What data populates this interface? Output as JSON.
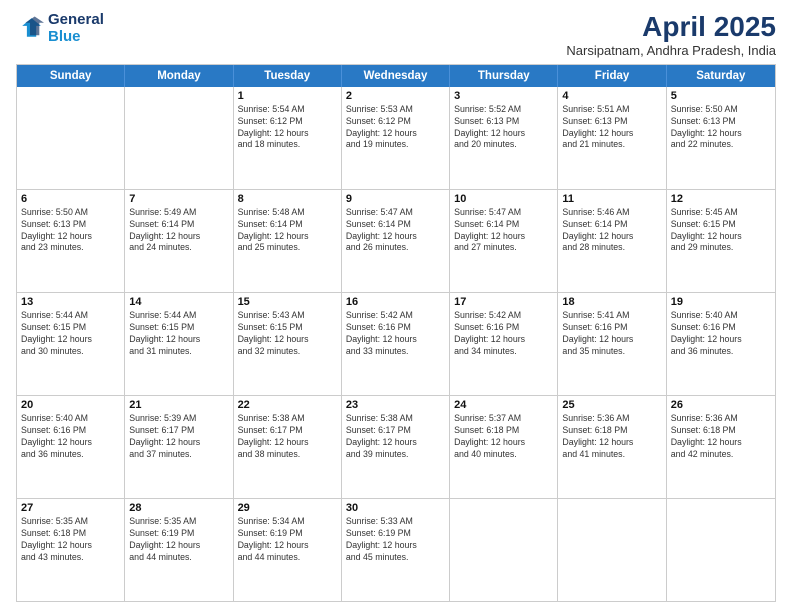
{
  "logo": {
    "line1": "General",
    "line2": "Blue"
  },
  "title": "April 2025",
  "subtitle": "Narsipatnam, Andhra Pradesh, India",
  "headers": [
    "Sunday",
    "Monday",
    "Tuesday",
    "Wednesday",
    "Thursday",
    "Friday",
    "Saturday"
  ],
  "weeks": [
    [
      {
        "day": "",
        "info": ""
      },
      {
        "day": "",
        "info": ""
      },
      {
        "day": "1",
        "info": "Sunrise: 5:54 AM\nSunset: 6:12 PM\nDaylight: 12 hours\nand 18 minutes."
      },
      {
        "day": "2",
        "info": "Sunrise: 5:53 AM\nSunset: 6:12 PM\nDaylight: 12 hours\nand 19 minutes."
      },
      {
        "day": "3",
        "info": "Sunrise: 5:52 AM\nSunset: 6:13 PM\nDaylight: 12 hours\nand 20 minutes."
      },
      {
        "day": "4",
        "info": "Sunrise: 5:51 AM\nSunset: 6:13 PM\nDaylight: 12 hours\nand 21 minutes."
      },
      {
        "day": "5",
        "info": "Sunrise: 5:50 AM\nSunset: 6:13 PM\nDaylight: 12 hours\nand 22 minutes."
      }
    ],
    [
      {
        "day": "6",
        "info": "Sunrise: 5:50 AM\nSunset: 6:13 PM\nDaylight: 12 hours\nand 23 minutes."
      },
      {
        "day": "7",
        "info": "Sunrise: 5:49 AM\nSunset: 6:14 PM\nDaylight: 12 hours\nand 24 minutes."
      },
      {
        "day": "8",
        "info": "Sunrise: 5:48 AM\nSunset: 6:14 PM\nDaylight: 12 hours\nand 25 minutes."
      },
      {
        "day": "9",
        "info": "Sunrise: 5:47 AM\nSunset: 6:14 PM\nDaylight: 12 hours\nand 26 minutes."
      },
      {
        "day": "10",
        "info": "Sunrise: 5:47 AM\nSunset: 6:14 PM\nDaylight: 12 hours\nand 27 minutes."
      },
      {
        "day": "11",
        "info": "Sunrise: 5:46 AM\nSunset: 6:14 PM\nDaylight: 12 hours\nand 28 minutes."
      },
      {
        "day": "12",
        "info": "Sunrise: 5:45 AM\nSunset: 6:15 PM\nDaylight: 12 hours\nand 29 minutes."
      }
    ],
    [
      {
        "day": "13",
        "info": "Sunrise: 5:44 AM\nSunset: 6:15 PM\nDaylight: 12 hours\nand 30 minutes."
      },
      {
        "day": "14",
        "info": "Sunrise: 5:44 AM\nSunset: 6:15 PM\nDaylight: 12 hours\nand 31 minutes."
      },
      {
        "day": "15",
        "info": "Sunrise: 5:43 AM\nSunset: 6:15 PM\nDaylight: 12 hours\nand 32 minutes."
      },
      {
        "day": "16",
        "info": "Sunrise: 5:42 AM\nSunset: 6:16 PM\nDaylight: 12 hours\nand 33 minutes."
      },
      {
        "day": "17",
        "info": "Sunrise: 5:42 AM\nSunset: 6:16 PM\nDaylight: 12 hours\nand 34 minutes."
      },
      {
        "day": "18",
        "info": "Sunrise: 5:41 AM\nSunset: 6:16 PM\nDaylight: 12 hours\nand 35 minutes."
      },
      {
        "day": "19",
        "info": "Sunrise: 5:40 AM\nSunset: 6:16 PM\nDaylight: 12 hours\nand 36 minutes."
      }
    ],
    [
      {
        "day": "20",
        "info": "Sunrise: 5:40 AM\nSunset: 6:16 PM\nDaylight: 12 hours\nand 36 minutes."
      },
      {
        "day": "21",
        "info": "Sunrise: 5:39 AM\nSunset: 6:17 PM\nDaylight: 12 hours\nand 37 minutes."
      },
      {
        "day": "22",
        "info": "Sunrise: 5:38 AM\nSunset: 6:17 PM\nDaylight: 12 hours\nand 38 minutes."
      },
      {
        "day": "23",
        "info": "Sunrise: 5:38 AM\nSunset: 6:17 PM\nDaylight: 12 hours\nand 39 minutes."
      },
      {
        "day": "24",
        "info": "Sunrise: 5:37 AM\nSunset: 6:18 PM\nDaylight: 12 hours\nand 40 minutes."
      },
      {
        "day": "25",
        "info": "Sunrise: 5:36 AM\nSunset: 6:18 PM\nDaylight: 12 hours\nand 41 minutes."
      },
      {
        "day": "26",
        "info": "Sunrise: 5:36 AM\nSunset: 6:18 PM\nDaylight: 12 hours\nand 42 minutes."
      }
    ],
    [
      {
        "day": "27",
        "info": "Sunrise: 5:35 AM\nSunset: 6:18 PM\nDaylight: 12 hours\nand 43 minutes."
      },
      {
        "day": "28",
        "info": "Sunrise: 5:35 AM\nSunset: 6:19 PM\nDaylight: 12 hours\nand 44 minutes."
      },
      {
        "day": "29",
        "info": "Sunrise: 5:34 AM\nSunset: 6:19 PM\nDaylight: 12 hours\nand 44 minutes."
      },
      {
        "day": "30",
        "info": "Sunrise: 5:33 AM\nSunset: 6:19 PM\nDaylight: 12 hours\nand 45 minutes."
      },
      {
        "day": "",
        "info": ""
      },
      {
        "day": "",
        "info": ""
      },
      {
        "day": "",
        "info": ""
      }
    ]
  ]
}
